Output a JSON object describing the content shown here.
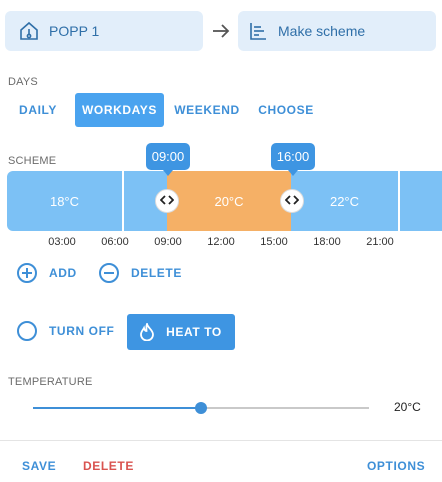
{
  "header": {
    "device_label": "POPP 1",
    "target_label": "Make scheme"
  },
  "days": {
    "section_label": "DAYS",
    "tabs": [
      {
        "label": "DAILY",
        "active": false
      },
      {
        "label": "WORKDAYS",
        "active": true
      },
      {
        "label": "WEEKEND",
        "active": false
      },
      {
        "label": "CHOOSE",
        "active": false
      }
    ]
  },
  "scheme": {
    "section_label": "SCHEME",
    "segments": [
      {
        "label": "18°C",
        "color": "#7cc1f5"
      },
      {
        "label": "20°C",
        "color": "#f5b066"
      },
      {
        "label": "22°C",
        "color": "#7cc1f5"
      }
    ],
    "handles": [
      {
        "time": "09:00"
      },
      {
        "time": "16:00"
      }
    ],
    "ticks": [
      "03:00",
      "06:00",
      "09:00",
      "12:00",
      "15:00",
      "18:00",
      "21:00"
    ]
  },
  "actions": {
    "add_label": "ADD",
    "delete_label": "DELETE"
  },
  "mode": {
    "turn_off_label": "TURN OFF",
    "heat_to_label": "HEAT TO"
  },
  "temperature": {
    "section_label": "TEMPERATURE",
    "value_label": "20°C",
    "slider_fraction": 0.5
  },
  "footer": {
    "save_label": "SAVE",
    "delete_label": "DELETE",
    "options_label": "OPTIONS"
  },
  "colors": {
    "accent": "#3e8fd7",
    "danger": "#d9534f",
    "cold_segment": "#7cc1f5",
    "warm_segment": "#f5b066"
  }
}
